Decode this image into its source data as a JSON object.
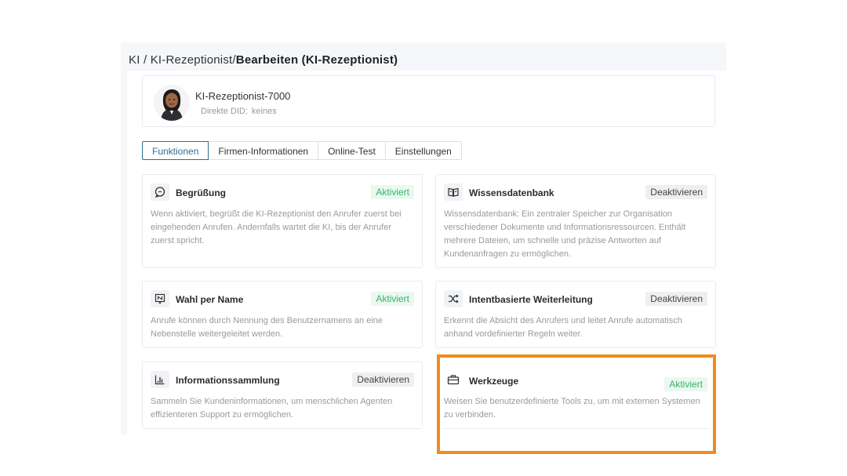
{
  "breadcrumb": {
    "part1": "KI",
    "sep1": " / ",
    "part2": "KI-Rezeptionist",
    "sep2": "/",
    "current": "Bearbeiten (KI-Rezeptionist)"
  },
  "agent": {
    "name": "KI-Rezeptionist-7000",
    "did_label": "Direkte DID:",
    "did_value": "keines"
  },
  "tabs": [
    {
      "label": "Funktionen",
      "active": true
    },
    {
      "label": "Firmen-Informationen"
    },
    {
      "label": "Online-Test"
    },
    {
      "label": "Einstellungen"
    }
  ],
  "cards": [
    {
      "icon": "chat-bubble-icon",
      "title": "Begrüßung",
      "status": "Aktiviert",
      "desc": "Wenn aktiviert, begrüßt die KI-Rezeptionist den Anrufer zuerst bei eingehenden Anrufen. Andernfalls wartet die KI, bis der Anrufer zuerst spricht."
    },
    {
      "icon": "book-icon",
      "title": "Wissensdatenbank",
      "status": "Deaktivieren",
      "desc": "Wissensdatenbank: Ein zentraler Speicher zur Organisation verschiedener Dokumente und Informationsressourcen. Enthält mehrere Dateien, um schnelle und präzise Antworten auf Kundenanfragen zu ermöglichen."
    },
    {
      "icon": "name-dial-icon",
      "title": "Wahl per Name",
      "status": "Aktiviert",
      "desc": "Anrufe können durch Nennung des Benutzernamens an eine Nebenstelle weitergeleitet werden."
    },
    {
      "icon": "shuffle-icon",
      "title": "Intentbasierte Weiterleitung",
      "status": "Deaktivieren",
      "desc": "Erkennt die Absicht des Anrufers und leitet Anrufe automatisch anhand vordefinierter Regeln weiter."
    },
    {
      "icon": "chart-bars-icon",
      "title": "Informationssammlung",
      "status": "Deaktivieren",
      "desc": "Sammeln Sie Kundeninformationen, um menschlichen Agenten effizienteren Support zu ermöglichen."
    },
    {
      "icon": "toolbox-icon",
      "title": "Werkzeuge",
      "status": "Aktiviert",
      "desc": "Weisen Sie benutzerdefinierte Tools zu, um mit externen Systemen zu verbinden."
    }
  ],
  "colors": {
    "active": "#36b36a",
    "highlight": "#f08c1e",
    "tab_active": "#2f6f8f"
  }
}
